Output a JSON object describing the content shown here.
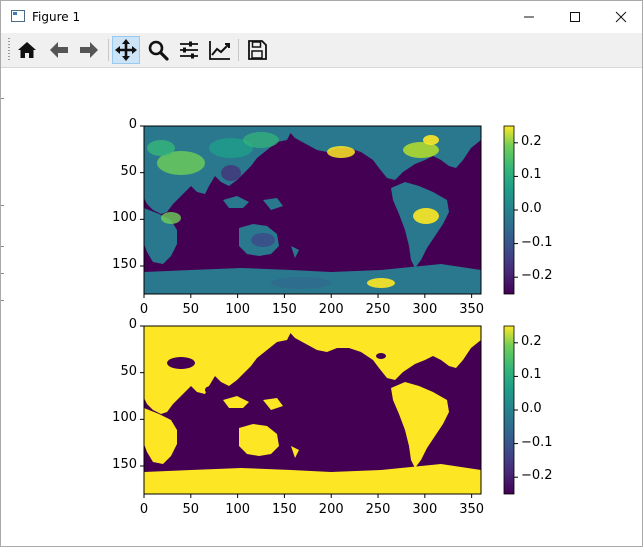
{
  "window": {
    "title": "Figure 1",
    "controls": [
      "minimize",
      "maximize",
      "close"
    ]
  },
  "toolbar": {
    "buttons": [
      {
        "name": "home-icon",
        "label": "Home"
      },
      {
        "name": "back-icon",
        "label": "Back"
      },
      {
        "name": "forward-icon",
        "label": "Forward"
      },
      {
        "name": "pan-icon",
        "label": "Pan",
        "active": true
      },
      {
        "name": "zoom-icon",
        "label": "Zoom"
      },
      {
        "name": "subplots-icon",
        "label": "Configure subplots"
      },
      {
        "name": "axes-icon",
        "label": "Edit axis"
      },
      {
        "name": "save-icon",
        "label": "Save"
      }
    ]
  },
  "chart_data": [
    {
      "type": "heatmap",
      "colormap": "viridis",
      "x_ticks": [
        "0",
        "50",
        "100",
        "150",
        "200",
        "250",
        "300",
        "350"
      ],
      "y_ticks": [
        "0",
        "50",
        "100",
        "150"
      ],
      "xlim": [
        0,
        360
      ],
      "ylim": [
        180,
        0
      ],
      "colorbar": {
        "range": [
          -0.25,
          0.25
        ],
        "ticks": [
          "0.2",
          "0.1",
          "0.0",
          "−0.1",
          "−0.2"
        ]
      }
    },
    {
      "type": "heatmap",
      "colormap": "viridis",
      "x_ticks": [
        "0",
        "50",
        "100",
        "150",
        "200",
        "250",
        "300",
        "350"
      ],
      "y_ticks": [
        "0",
        "50",
        "100",
        "150"
      ],
      "xlim": [
        0,
        360
      ],
      "ylim": [
        180,
        0
      ],
      "colorbar": {
        "range": [
          -0.25,
          0.25
        ],
        "ticks": [
          "0.2",
          "0.1",
          "0.0",
          "−0.1",
          "−0.2"
        ]
      }
    }
  ],
  "colors": {
    "ocean": "#440154",
    "land_mask": "#fde725"
  }
}
